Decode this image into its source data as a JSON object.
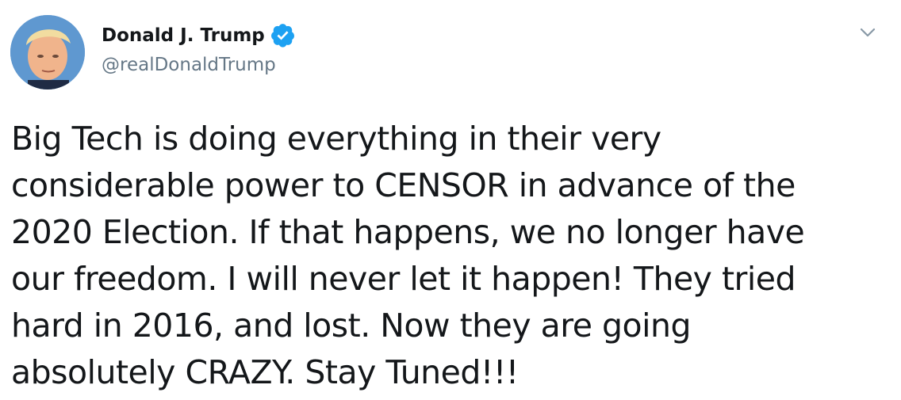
{
  "tweet": {
    "author": {
      "display_name": "Donald J. Trump",
      "handle": "@realDonaldTrump",
      "verified": true,
      "verified_color": "#1da1f2"
    },
    "text": "Big Tech is doing everything in their very\nconsiderable power to CENSOR in advance of the\n2020 Election. If that happens, we no longer have\nour freedom. I will never let it happen! They tried\nhard in 2016, and lost. Now they are going\nabsolutely CRAZY. Stay Tuned!!!",
    "menu_icon": "chevron-down-icon",
    "colors": {
      "text": "#14171a",
      "secondary": "#657786",
      "accent": "#1da1f2"
    }
  }
}
